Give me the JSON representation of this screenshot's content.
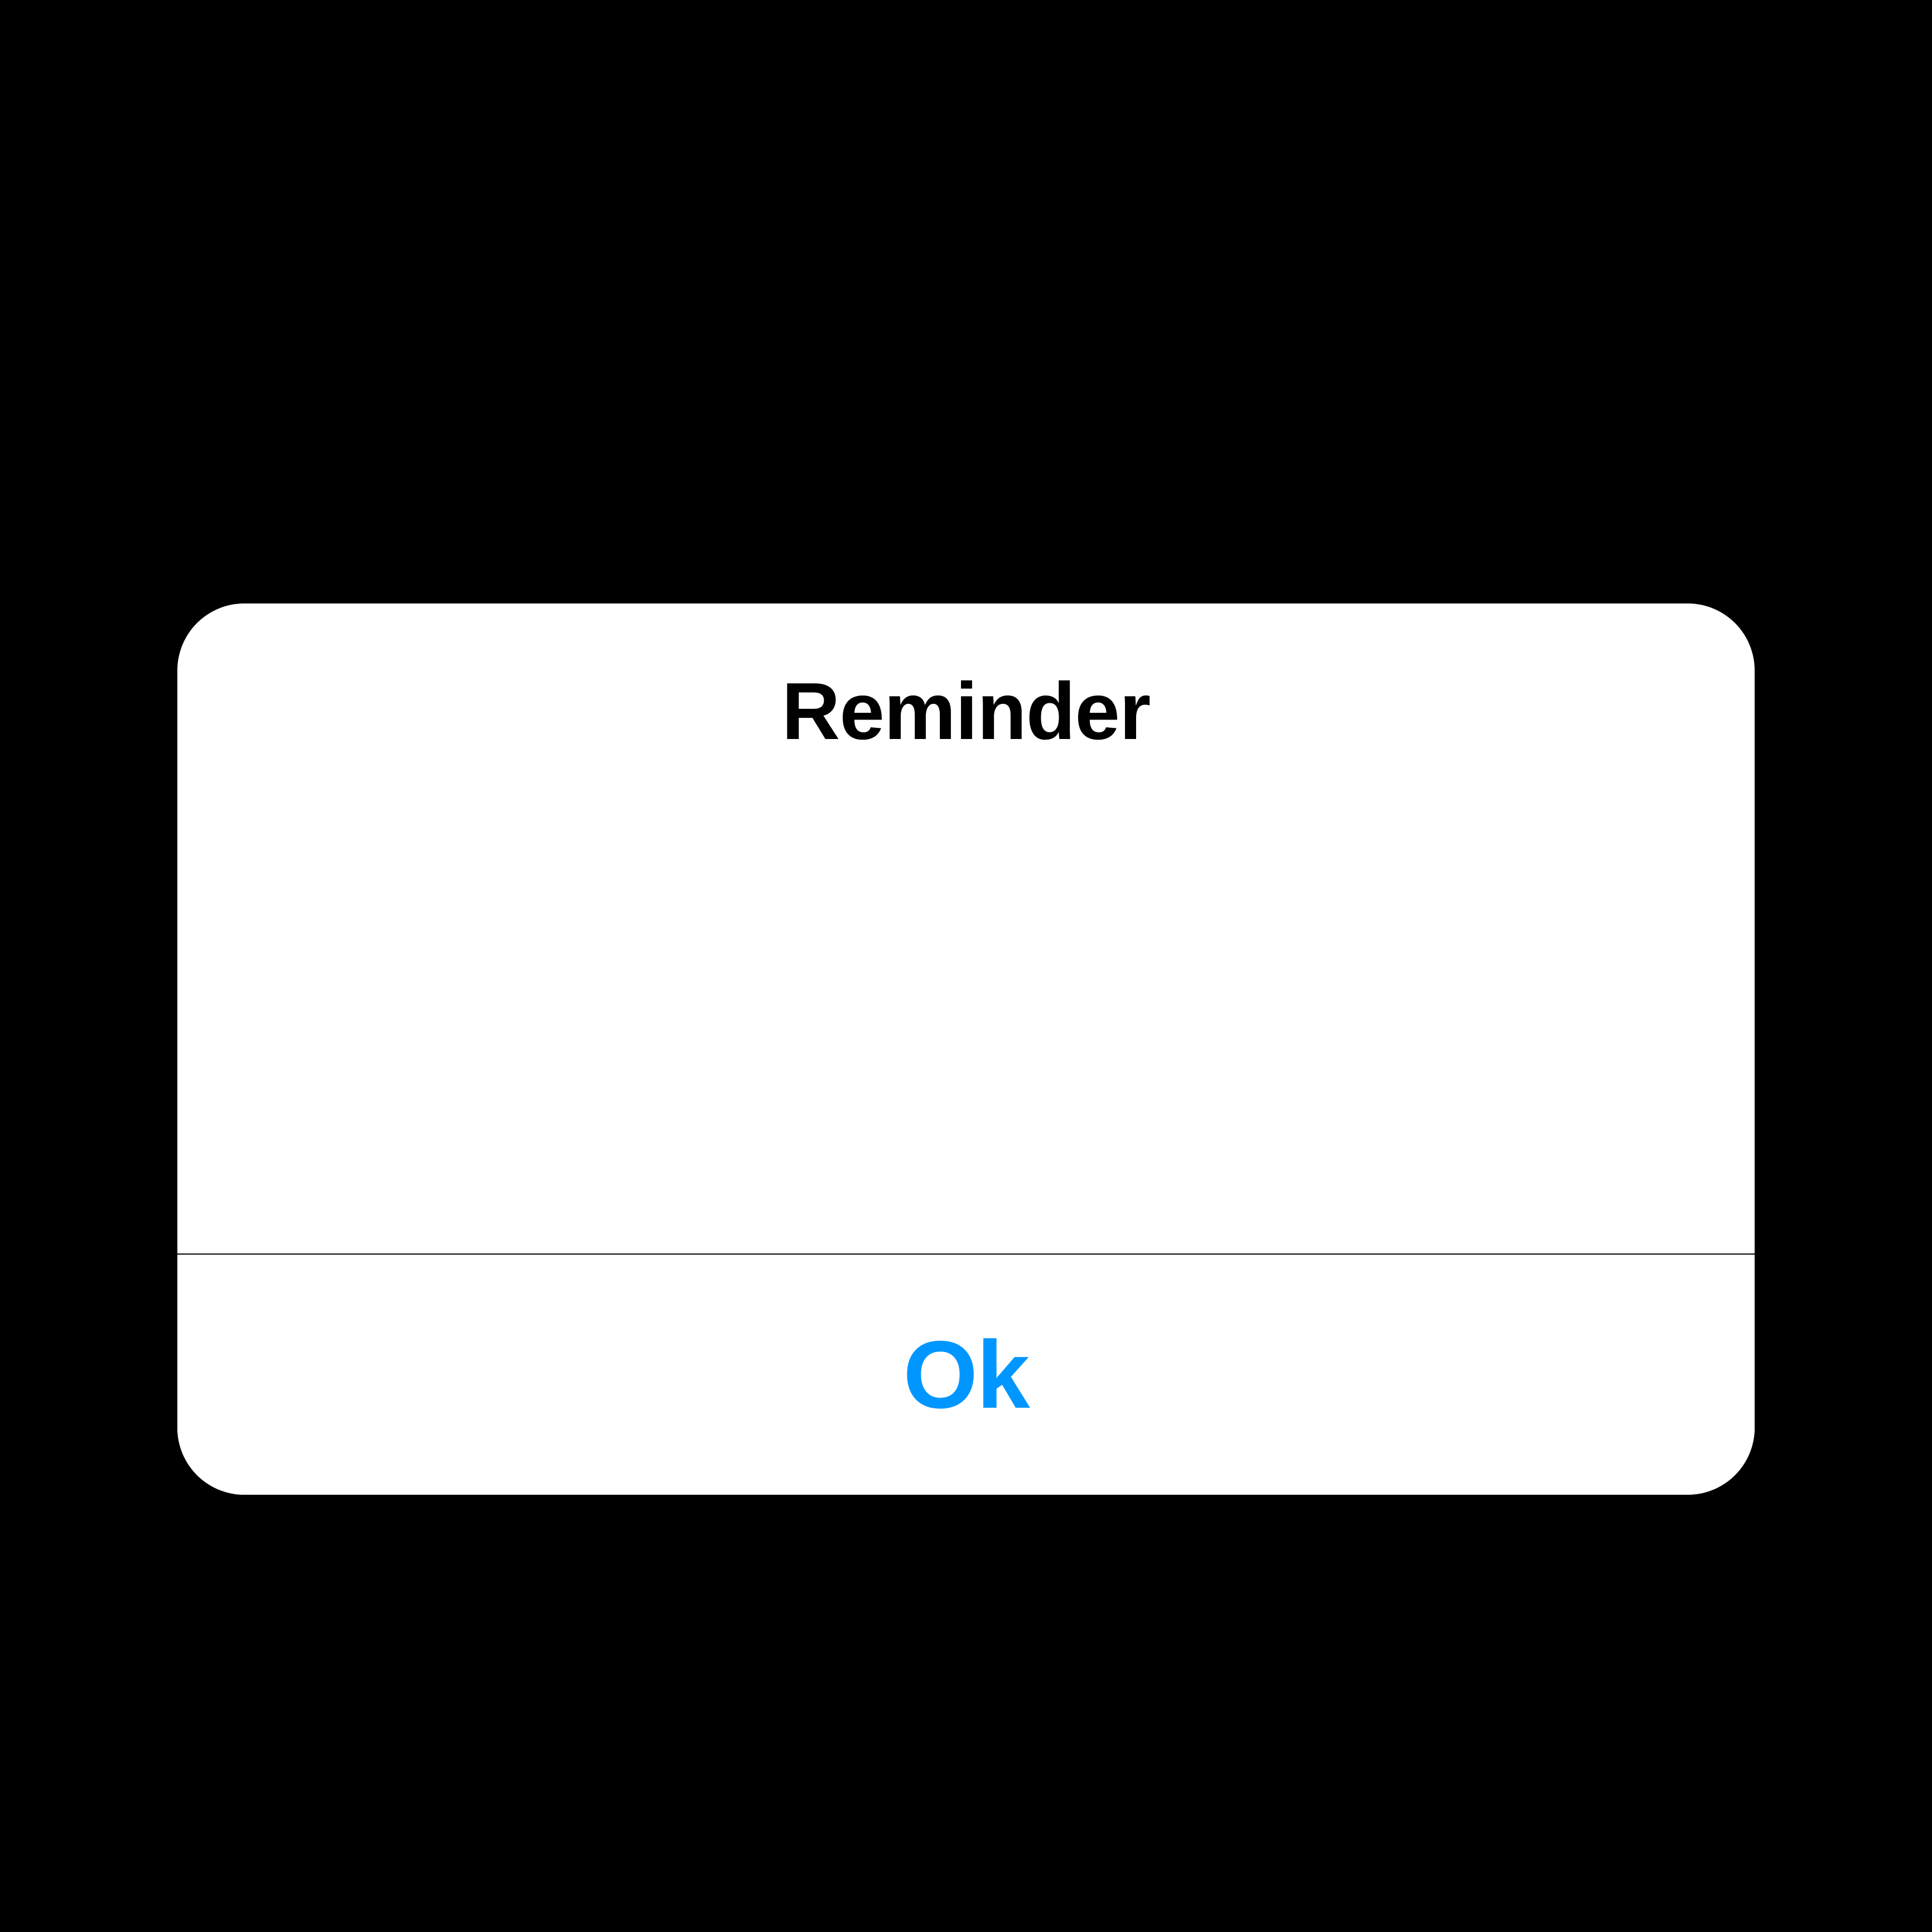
{
  "alert": {
    "title": "Reminder",
    "button_label": "Ok"
  }
}
